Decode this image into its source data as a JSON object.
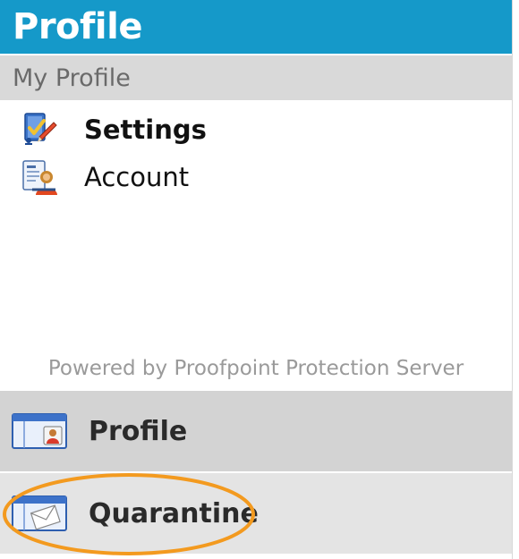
{
  "header": {
    "title": "Profile"
  },
  "subheader": {
    "title": "My Profile"
  },
  "menu": {
    "items": [
      {
        "label": "Settings",
        "icon": "settings-icon"
      },
      {
        "label": "Account",
        "icon": "account-icon"
      }
    ]
  },
  "footer": {
    "powered_by": "Powered by Proofpoint Protection Server"
  },
  "nav": {
    "profile_label": "Profile",
    "quarantine_label": "Quarantine"
  },
  "colors": {
    "header_bg": "#1599c9",
    "subheader_bg": "#d9d9d9",
    "nav_profile_bg": "#d3d3d3",
    "nav_quarantine_bg": "#e4e4e4",
    "highlight": "#f39a1f"
  }
}
